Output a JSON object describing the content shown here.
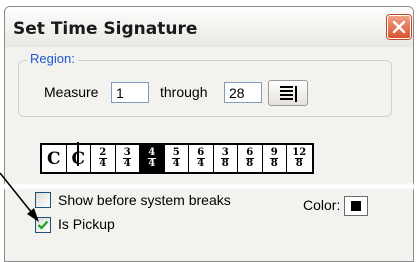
{
  "window": {
    "title": "Set Time Signature"
  },
  "region": {
    "legend": "Region:",
    "measure_label": "Measure",
    "measure_value": "1",
    "through_label": "through",
    "through_value": "28",
    "list_button_icon": "list-icon"
  },
  "time_signatures": {
    "selected_index": 4,
    "options": [
      {
        "kind": "symbol",
        "symbol": "C",
        "name": "common-time"
      },
      {
        "kind": "symbol",
        "symbol": "C",
        "name": "cut-time"
      },
      {
        "kind": "fraction",
        "top": "2",
        "bottom": "4"
      },
      {
        "kind": "fraction",
        "top": "3",
        "bottom": "4"
      },
      {
        "kind": "fraction",
        "top": "4",
        "bottom": "4"
      },
      {
        "kind": "fraction",
        "top": "5",
        "bottom": "4"
      },
      {
        "kind": "fraction",
        "top": "6",
        "bottom": "4"
      },
      {
        "kind": "fraction",
        "top": "3",
        "bottom": "8"
      },
      {
        "kind": "fraction",
        "top": "6",
        "bottom": "8"
      },
      {
        "kind": "fraction",
        "top": "9",
        "bottom": "8"
      },
      {
        "kind": "fraction",
        "top": "12",
        "bottom": "8"
      }
    ]
  },
  "options": {
    "show_before_breaks": {
      "label": "Show before system breaks",
      "checked": false
    },
    "is_pickup": {
      "label": "Is Pickup",
      "checked": true
    }
  },
  "color": {
    "label": "Color:",
    "value": "#000000"
  },
  "colors": {
    "legend_blue": "#1f56d6",
    "close_red": "#d6542e",
    "check_green": "#21a121"
  }
}
